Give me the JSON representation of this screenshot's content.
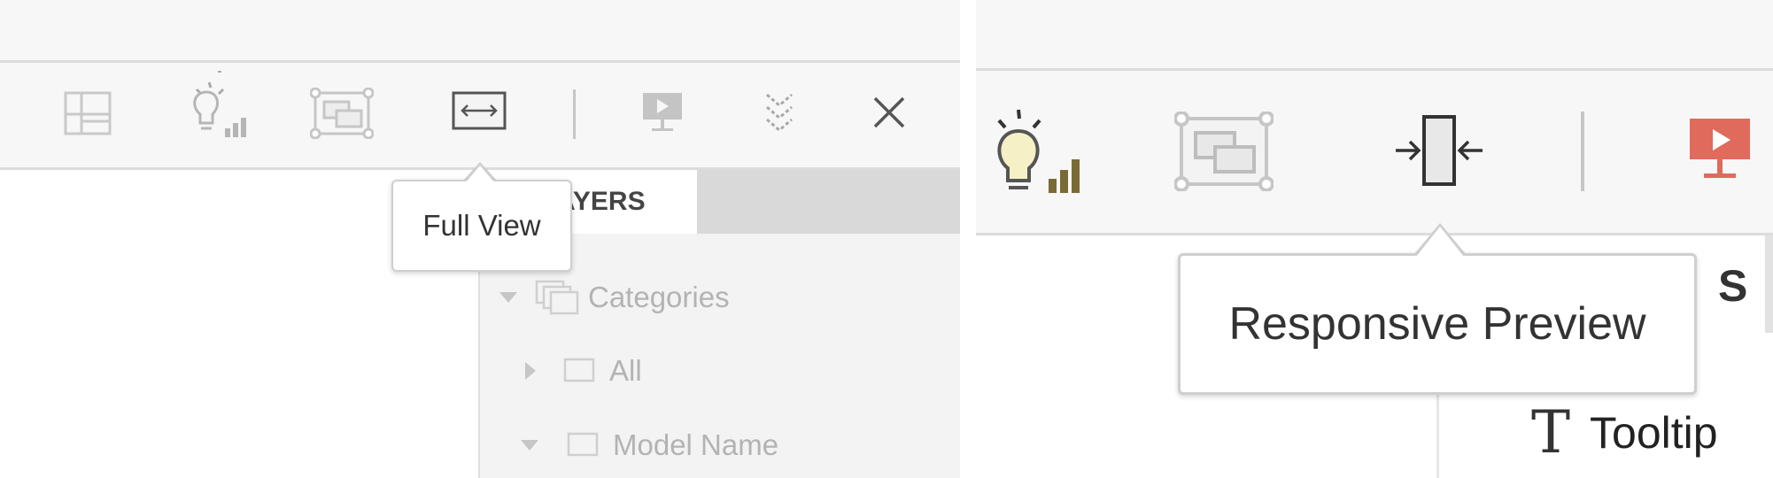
{
  "left": {
    "toolbar": {
      "items": [
        {
          "name": "layout-icon"
        },
        {
          "name": "lightbulb-insights-icon"
        },
        {
          "name": "presentation-frames-icon"
        },
        {
          "name": "full-view-icon"
        },
        {
          "name": "presentation-mode-icon"
        },
        {
          "name": "expand-down-icon"
        },
        {
          "name": "close-icon"
        }
      ]
    },
    "tooltip": "Full View",
    "layers_tab": "AYERS",
    "tree": [
      {
        "label": "Categories",
        "expanded": true
      },
      {
        "label": "All",
        "expanded": false
      },
      {
        "label": "Model Name",
        "expanded": true
      }
    ]
  },
  "right": {
    "tooltip": "Responsive Preview",
    "partial_heading": "S",
    "tooltip_item": "Tooltip",
    "colors": {
      "presentation_active": "#e06b5c",
      "bulb_bars": "#7a6b35"
    }
  }
}
